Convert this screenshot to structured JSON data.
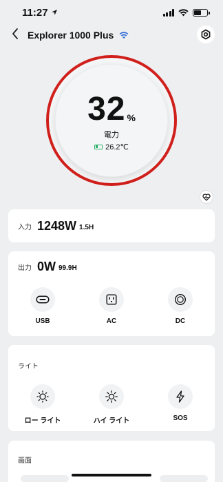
{
  "status_bar": {
    "time": "11:27"
  },
  "nav": {
    "title": "Explorer 1000 Plus"
  },
  "gauge": {
    "percent": "32",
    "unit": "%",
    "label": "電力",
    "temperature": "26.2℃"
  },
  "input": {
    "label": "入力",
    "watts": "1248W",
    "hours": "1.5H"
  },
  "output": {
    "label": "出力",
    "watts": "0W",
    "hours": "99.9H",
    "ports": [
      {
        "label": "USB"
      },
      {
        "label": "AC"
      },
      {
        "label": "DC"
      }
    ]
  },
  "light": {
    "title": "ライト",
    "modes": [
      {
        "label": "ロー ライト"
      },
      {
        "label": "ハイ ライト"
      },
      {
        "label": "SOS"
      }
    ]
  },
  "screen": {
    "title": "画面"
  },
  "colors": {
    "ring": "#d0201c",
    "wifi": "#2f6bd6",
    "battery_mini": "#2bb06a"
  },
  "icons": [
    "back-arrow-icon",
    "wifi-icon",
    "settings-icon",
    "heart-icon",
    "usb-c-icon",
    "ac-outlet-icon",
    "dc-port-icon",
    "sun-low-icon",
    "sun-high-icon",
    "lightning-icon"
  ]
}
